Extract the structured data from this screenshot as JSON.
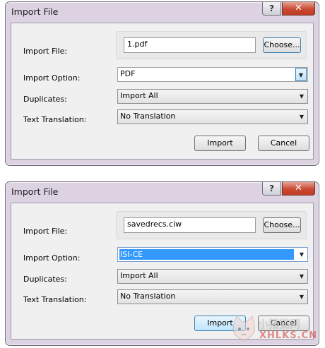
{
  "dialog1": {
    "title": "Import File",
    "help": "?",
    "close": "✕",
    "import_file_label": "Import File:",
    "file_value": "1.pdf",
    "choose": "Choose...",
    "import_option_label": "Import Option:",
    "import_option_value": "PDF",
    "duplicates_label": "Duplicates:",
    "duplicates_value": "Import All",
    "translation_label": "Text Translation:",
    "translation_value": "No Translation",
    "import": "Import",
    "cancel": "Cancel"
  },
  "dialog2": {
    "title": "Import File",
    "help": "?",
    "close": "✕",
    "import_file_label": "Import File:",
    "file_value": "savedrecs.ciw",
    "choose": "Choose...",
    "import_option_label": "Import Option:",
    "import_option_value": "ISI-CE",
    "duplicates_label": "Duplicates:",
    "duplicates_value": "Import All",
    "translation_label": "Text Translation:",
    "translation_value": "No Translation",
    "import": "Import",
    "cancel": "Cancel"
  },
  "watermark": {
    "line1": "小猪猫网",
    "line2": "XHLKS.CN"
  },
  "icons": {
    "dropdown": "triangle-down-icon",
    "help": "question-icon",
    "close": "x-icon"
  }
}
